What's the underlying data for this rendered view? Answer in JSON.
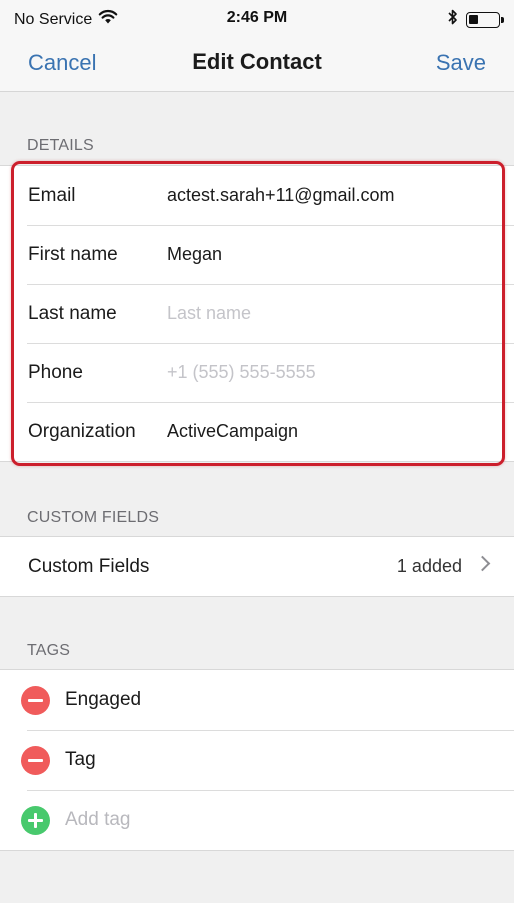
{
  "status_bar": {
    "carrier": "No Service",
    "time": "2:46 PM",
    "icons": [
      "wifi-icon",
      "bluetooth-icon",
      "battery-icon"
    ]
  },
  "nav": {
    "cancel_label": "Cancel",
    "title": "Edit Contact",
    "save_label": "Save"
  },
  "details": {
    "header": "DETAILS",
    "fields": [
      {
        "label": "Email",
        "value": "actest.sarah+11@gmail.com",
        "placeholder": ""
      },
      {
        "label": "First name",
        "value": "Megan",
        "placeholder": ""
      },
      {
        "label": "Last name",
        "value": "",
        "placeholder": "Last name"
      },
      {
        "label": "Phone",
        "value": "",
        "placeholder": "+1 (555) 555-5555"
      },
      {
        "label": "Organization",
        "value": "ActiveCampaign",
        "placeholder": ""
      }
    ]
  },
  "custom_fields": {
    "header": "CUSTOM FIELDS",
    "label": "Custom Fields",
    "detail": "1 added"
  },
  "tags": {
    "header": "TAGS",
    "items": [
      "Engaged",
      "Tag"
    ],
    "add_placeholder": "Add tag"
  },
  "colors": {
    "accent": "#3a73b1",
    "highlight": "#cc1f2c",
    "remove": "#f05b5b",
    "add": "#48c96d"
  }
}
